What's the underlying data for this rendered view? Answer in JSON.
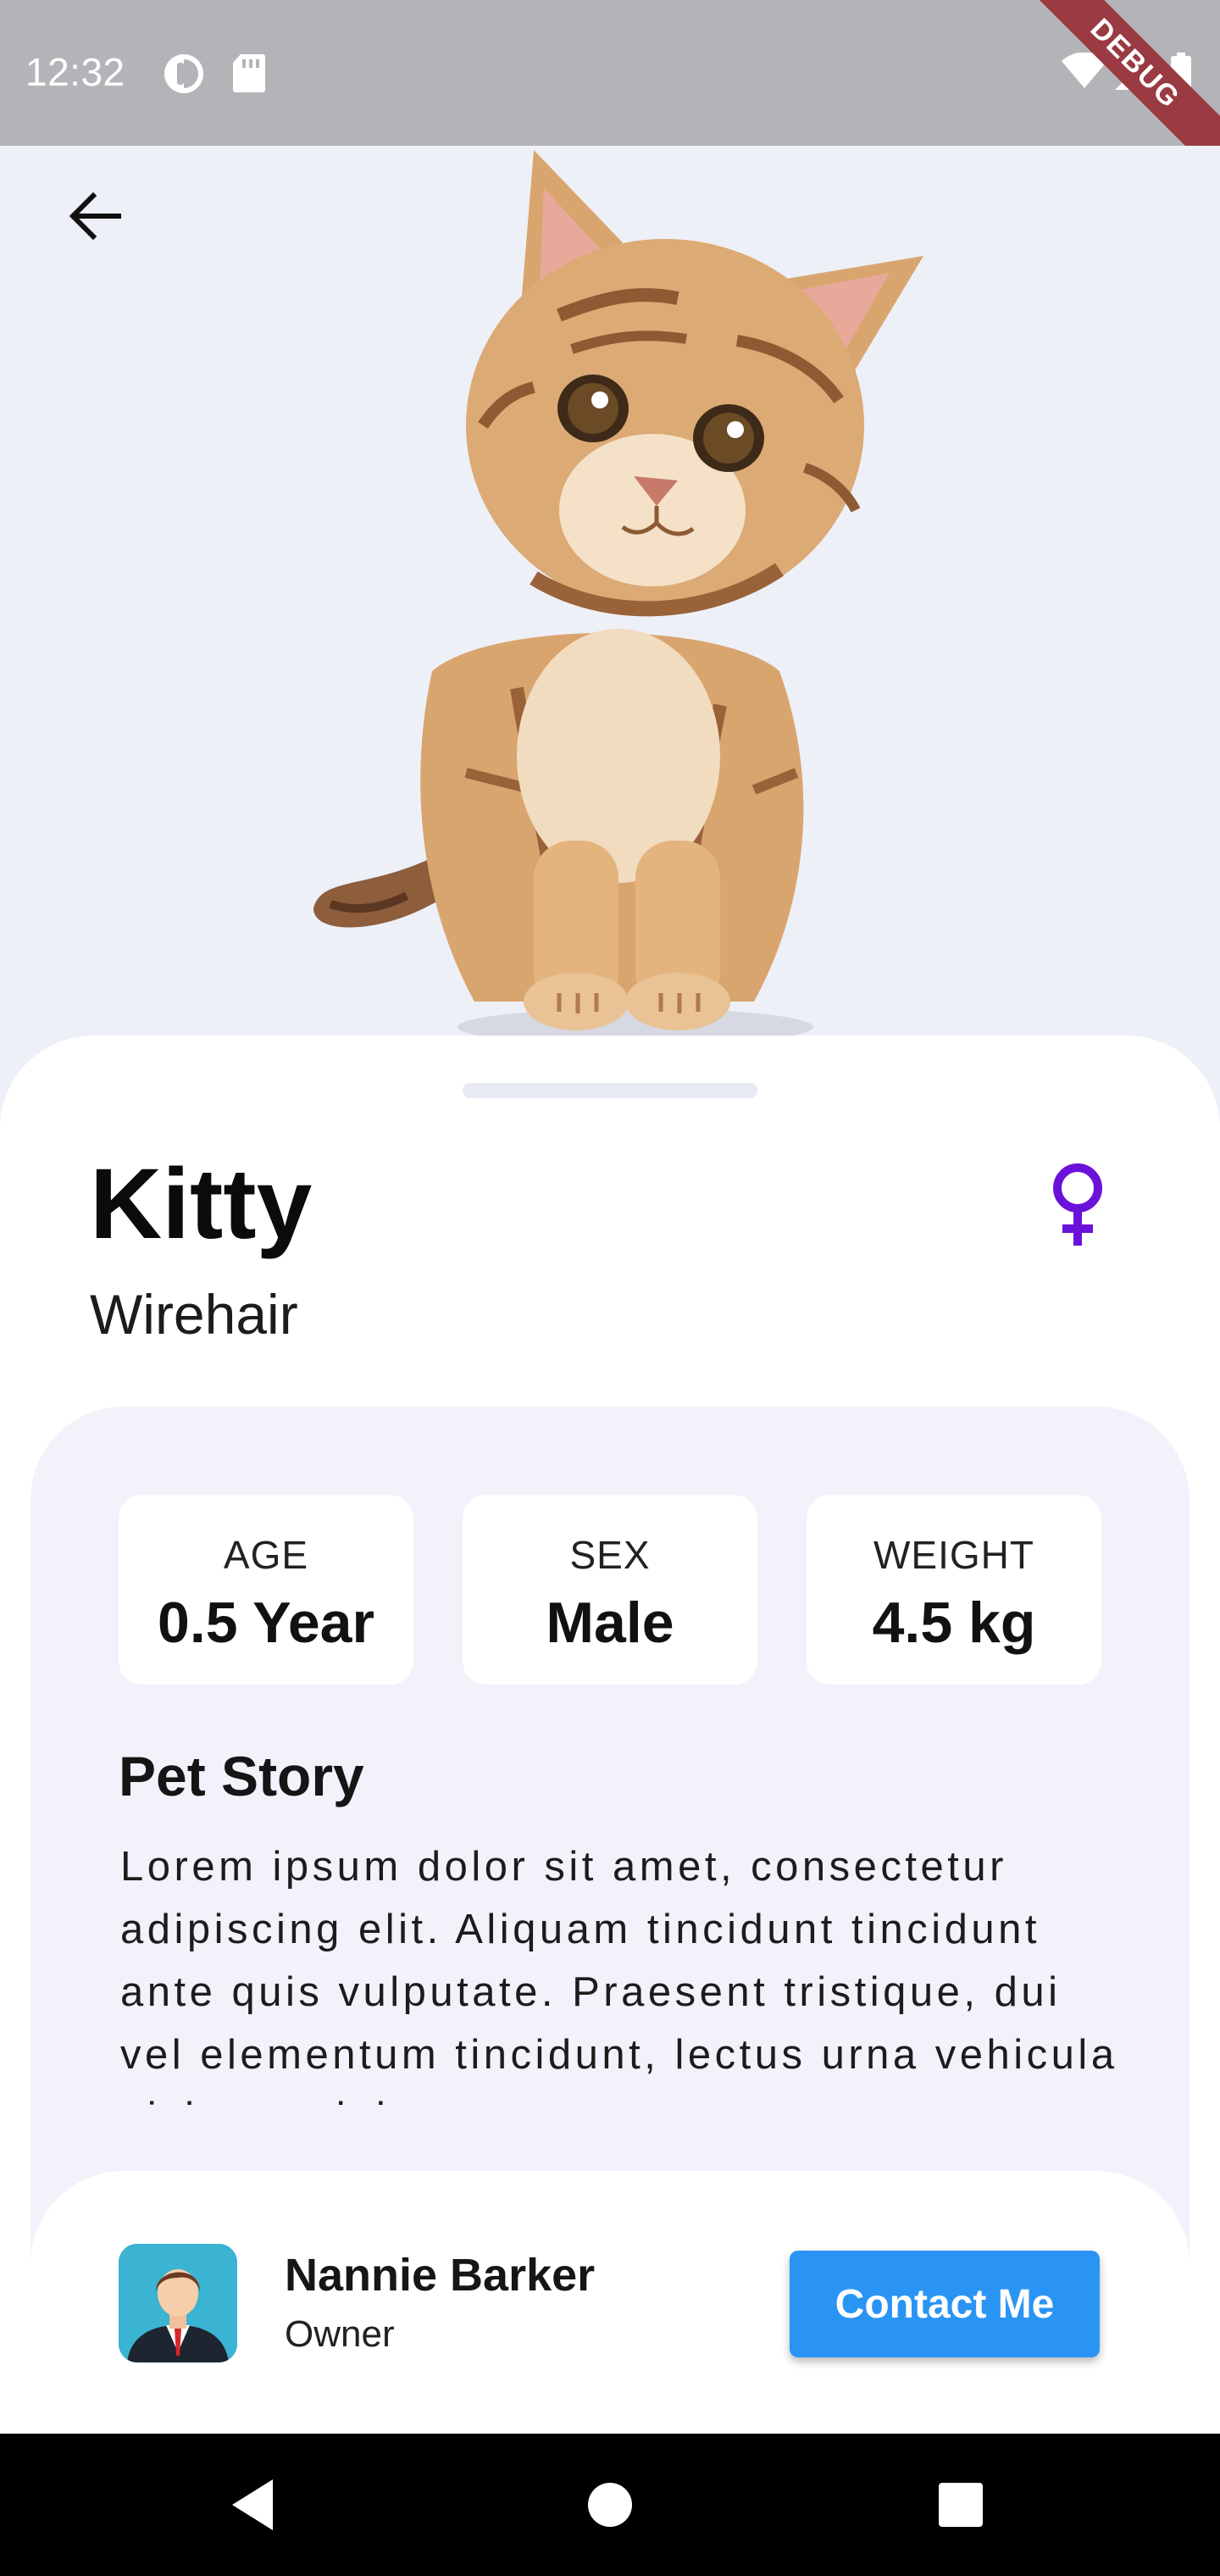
{
  "status_bar": {
    "time": "12:32",
    "debug_label": "DEBUG",
    "icons": [
      "privacy-dot-icon",
      "sd-card-icon",
      "wifi-icon",
      "signal-icon",
      "battery-icon"
    ]
  },
  "hero": {
    "back_icon": "arrow-back-icon",
    "image_subject": "kitten"
  },
  "pet": {
    "name": "Kitty",
    "breed": "Wirehair",
    "gender_icon": "female-icon",
    "gender_color": "#6a12d9"
  },
  "stats": [
    {
      "label": "AGE",
      "value": "0.5 Year"
    },
    {
      "label": "SEX",
      "value": "Male"
    },
    {
      "label": "WEIGHT",
      "value": "4.5 kg"
    }
  ],
  "story": {
    "title": "Pet Story",
    "text": "Lorem ipsum dolor sit amet, consectetur adipiscing elit. Aliquam tincidunt tincidunt ante quis vulputate. Praesent tristique, dui vel elementum tincidunt, lectus urna vehicula nisl, a sodales"
  },
  "owner": {
    "name": "Nannie Barker",
    "role": "Owner",
    "contact_label": "Contact Me",
    "accent_color": "#2a94f4"
  },
  "nav": {
    "icons": [
      "back-triangle-icon",
      "home-circle-icon",
      "recents-square-icon"
    ]
  }
}
